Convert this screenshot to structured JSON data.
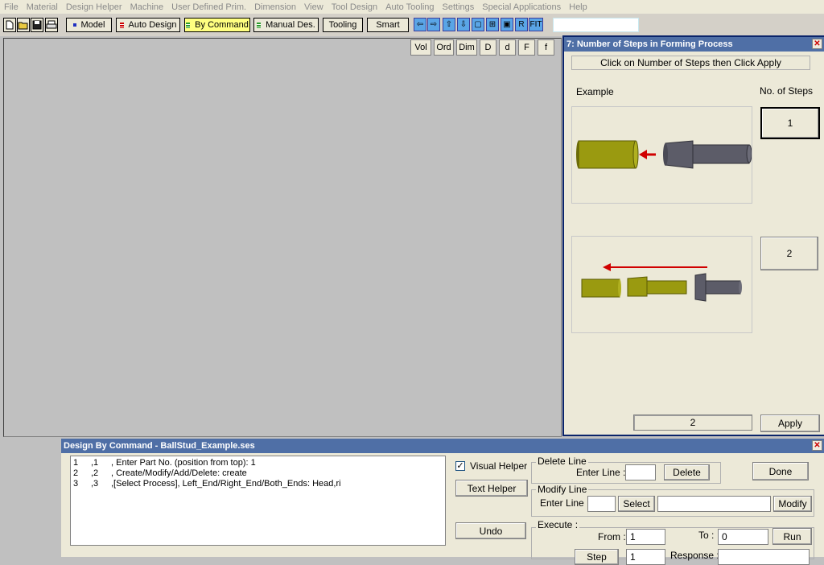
{
  "menu": [
    "File",
    "Material",
    "Design Helper",
    "Machine",
    "User Defined Prim.",
    "Dimension",
    "View",
    "Tool Design",
    "Auto Tooling",
    "Settings",
    "Special Applications",
    "Help"
  ],
  "toolbar": {
    "model": "Model",
    "auto_design": "Auto Design",
    "by_command": "By Command",
    "manual_des": "Manual Des.",
    "tooling": "Tooling",
    "smart": "Smart",
    "r_label": "R",
    "fit_label": "FIT"
  },
  "view_buttons": [
    "Vol",
    "Ord",
    "Dim",
    "D",
    "d",
    "F",
    "f"
  ],
  "steps_panel": {
    "title": "7: Number of Steps in Forming Process",
    "instruction": "Click on Number of Steps  then Click Apply",
    "example_label": "Example",
    "steps_label": "No. of  Steps",
    "option1": "1",
    "option2": "2",
    "selected_value": "2",
    "apply": "Apply"
  },
  "dbc_panel": {
    "title": "Design By Command - BallStud_Example.ses",
    "lines": [
      {
        "num": "1",
        "sub": ",1",
        "text": ", Enter Part No. (position from top):  1"
      },
      {
        "num": "2",
        "sub": ",2",
        "text": ", Create/Modify/Add/Delete:  create"
      },
      {
        "num": "3",
        "sub": ",3",
        "text": ",[Select Process], Left_End/Right_End/Both_Ends:  Head,ri"
      }
    ],
    "visual_helper": "Visual Helper",
    "text_helper": "Text Helper",
    "undo": "Undo",
    "delete_line": {
      "legend": "Delete Line",
      "enter_label": "Enter Line :",
      "button": "Delete"
    },
    "modify_line": {
      "legend": "Modify Line",
      "enter_label": "Enter Line :",
      "select": "Select",
      "modify": "Modify"
    },
    "execute": {
      "legend": "Execute :",
      "from_label": "From :",
      "from_value": "1",
      "to_label": "To :",
      "to_value": "0",
      "run": "Run",
      "step": "Step",
      "step_value": "1",
      "response_label": "Response :"
    },
    "done": "Done"
  },
  "colors": {
    "titlebar": "#4f6fa6",
    "part": "#9a9a10",
    "tool": "#5c5c68",
    "arrow": "#d00000"
  }
}
